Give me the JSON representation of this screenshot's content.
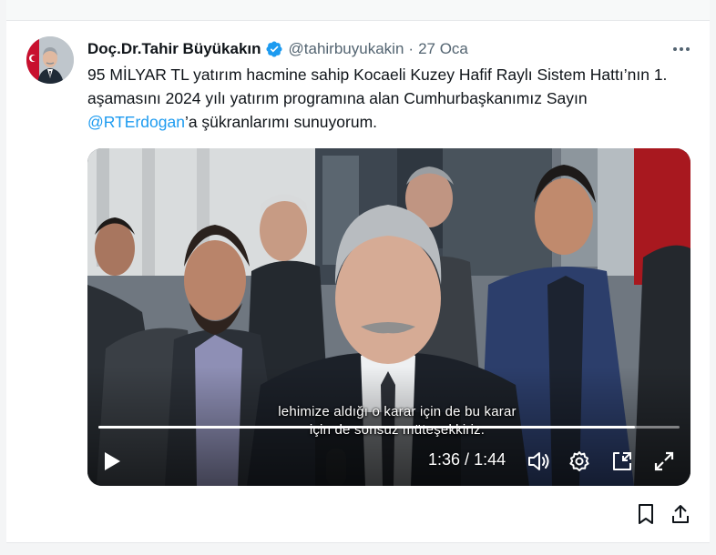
{
  "tweet": {
    "author_name": "Doç.Dr.Tahir Büyükakın",
    "handle": "@tahirbuyukakin",
    "separator": "·",
    "date": "27 Oca",
    "text_part1": "95 MİLYAR TL yatırım hacmine sahip Kocaeli Kuzey Hafif Raylı Sistem Hattı’nın 1. aşamasını 2024 yılı yatırım programına alan Cumhurbaşkanımız Sayın ",
    "mention": "@RTErdogan",
    "text_part2": "’a şükranlarımı sunuyorum."
  },
  "video": {
    "subtitle_line1": "lehimize aldığı o karar için de bu karar",
    "subtitle_line2": "için de sonsuz müteşekkiriz.",
    "current_time": "1:36",
    "time_separator": " / ",
    "duration": "1:44",
    "progress_fraction": 0.923
  },
  "icons": {
    "verified": "verified-badge-icon",
    "more": "more-options-icon",
    "play": "play-icon",
    "volume": "volume-icon",
    "settings": "gear-icon",
    "pip": "picture-in-picture-icon",
    "fullscreen": "fullscreen-icon",
    "bookmark": "bookmark-icon",
    "share": "share-icon"
  },
  "colors": {
    "accent": "#1d9bf0",
    "secondary_text": "#536471",
    "primary_text": "#0f1419"
  }
}
